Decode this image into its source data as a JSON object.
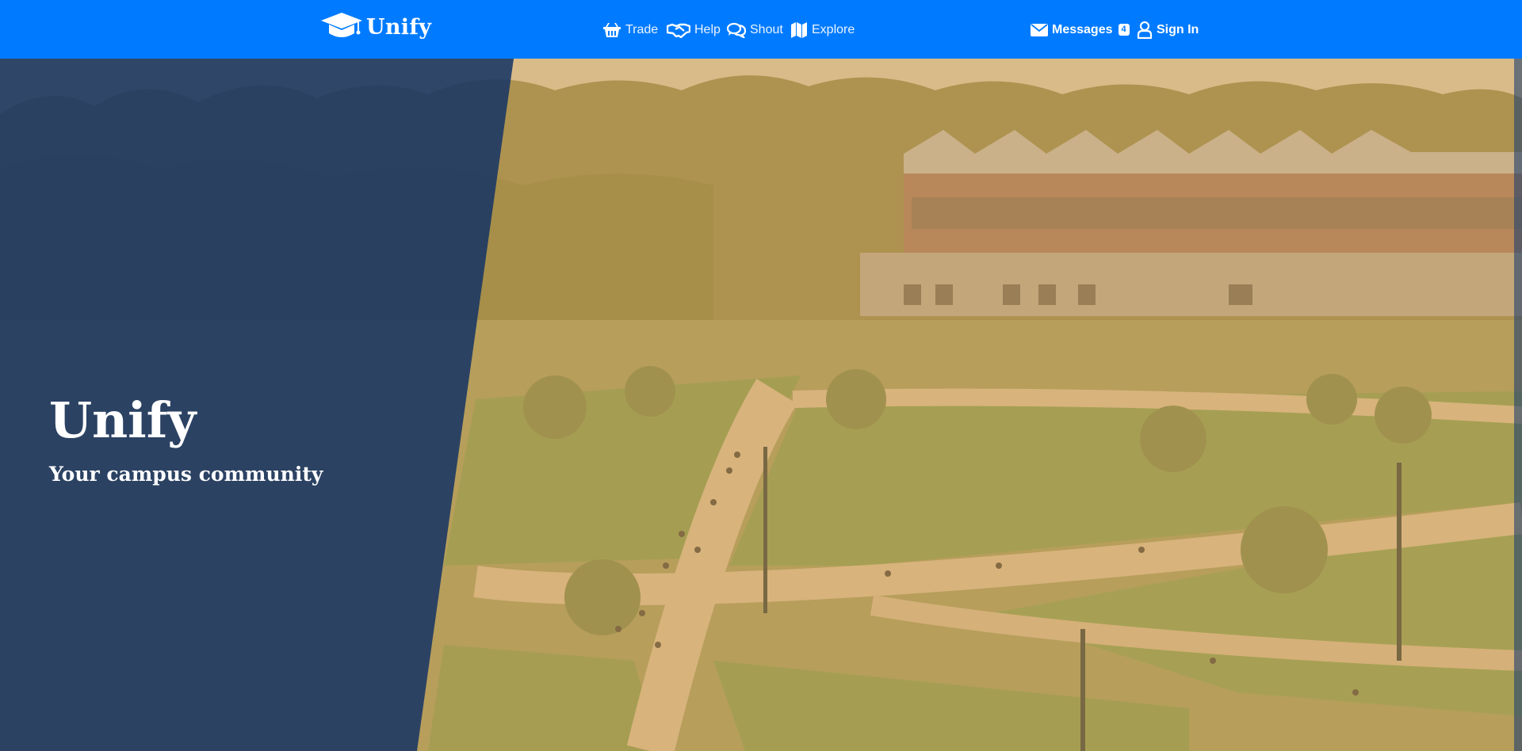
{
  "navbar": {
    "brand": {
      "name": "Unify",
      "icon": "graduation-cap-icon"
    },
    "links": [
      {
        "label": "Trade",
        "icon": "basket-icon"
      },
      {
        "label": "Help",
        "icon": "handshake-icon"
      },
      {
        "label": "Shout",
        "icon": "comments-icon"
      },
      {
        "label": "Explore",
        "icon": "map-icon"
      }
    ],
    "messages": {
      "label": "Messages",
      "count": "4",
      "icon": "envelope-icon"
    },
    "sign_in": {
      "label": "Sign In",
      "icon": "user-icon"
    }
  },
  "hero": {
    "title": "Unify",
    "subtitle": "Your campus community",
    "background": "campus-photo"
  },
  "colors": {
    "primary": "#007bff",
    "hero_overlay": "#183664",
    "photo_tint": "#c9a064"
  }
}
